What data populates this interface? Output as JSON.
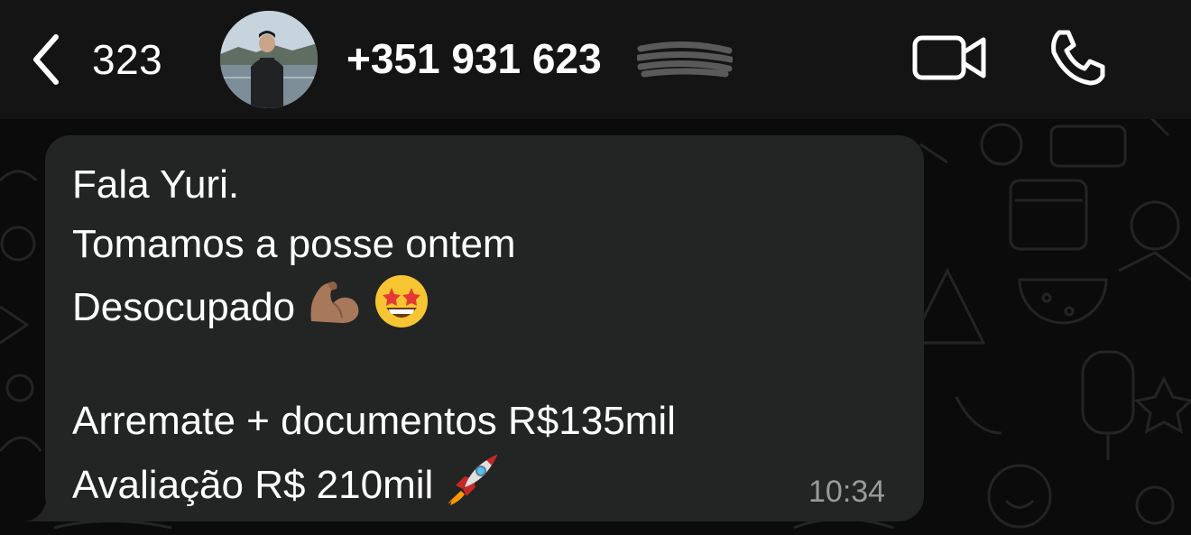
{
  "header": {
    "back_count": "323",
    "contact_name": "+351 931 623",
    "icons": {
      "back": "chevron-left-icon",
      "video": "video-camera-icon",
      "call": "phone-icon"
    }
  },
  "message": {
    "lines": [
      "Fala Yuri.",
      "Tomamos a posse ontem",
      "Desocupado",
      "",
      "Arremate + documentos R$135mil",
      "Avaliação R$ 210mil"
    ],
    "time": "10:34",
    "emojis": [
      "flexed-biceps",
      "star-struck",
      "rocket"
    ]
  },
  "colors": {
    "background": "#0b0b0b",
    "header": "#141414",
    "bubble": "#232424",
    "timestamp": "#9a9a9a"
  }
}
